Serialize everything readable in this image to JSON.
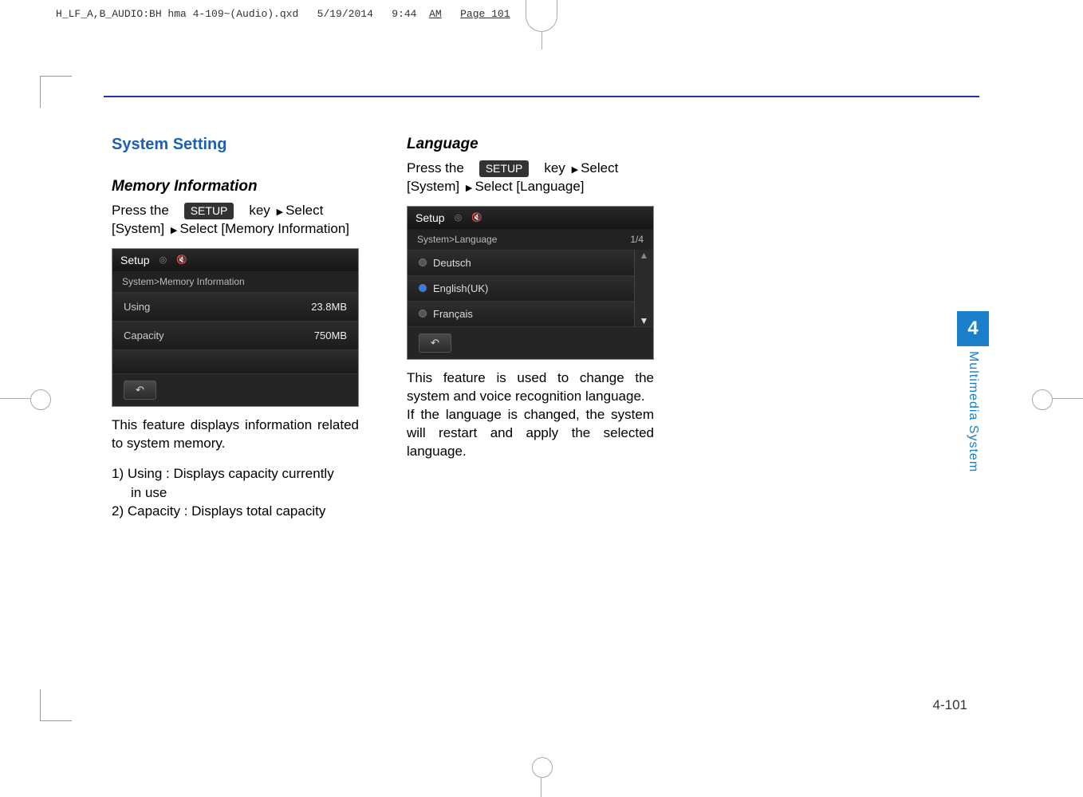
{
  "header": {
    "file_prefix": "H_LF_A,B_AUDIO:BH hma 4-109~(Audio).qxd",
    "date": "5/19/2014",
    "time": "9:44",
    "ampm": "AM",
    "page": "Page 101"
  },
  "left_col": {
    "section_title": "System Setting",
    "sub_title": "Memory Information",
    "press_the": "Press   the",
    "setup_label": "SETUP",
    "key_select": "key",
    "select_word": "Select",
    "breadcrumb": "[System]",
    "select2": "Select [Memory Information]",
    "screen": {
      "title": "Setup",
      "sub": "System>Memory Information",
      "row1_label": "Using",
      "row1_value": "23.8MB",
      "row2_label": "Capacity",
      "row2_value": "750MB"
    },
    "desc": "This feature displays information related to system memory.",
    "item1_pre": "1) Using : Displays capacity currently",
    "item1_indent": "in use",
    "item2": "2) Capacity : Displays total capacity"
  },
  "right_col": {
    "sub_title": "Language",
    "press_the": "Press   the",
    "setup_label": "SETUP",
    "key": "key",
    "select_word": "Select",
    "breadcrumb": "[System]",
    "select2": "Select [Language]",
    "screen": {
      "title": "Setup",
      "sub": "System>Language",
      "page_indicator": "1/4",
      "opt1": "Deutsch",
      "opt2": "English(UK)",
      "opt3": "Français"
    },
    "desc1": "This feature is used to change the system and voice recognition language.",
    "desc2": "If the language is changed, the system will restart and apply the selected language."
  },
  "side": {
    "chapter": "4",
    "label": "Multimedia System"
  },
  "page_number": "4-101"
}
